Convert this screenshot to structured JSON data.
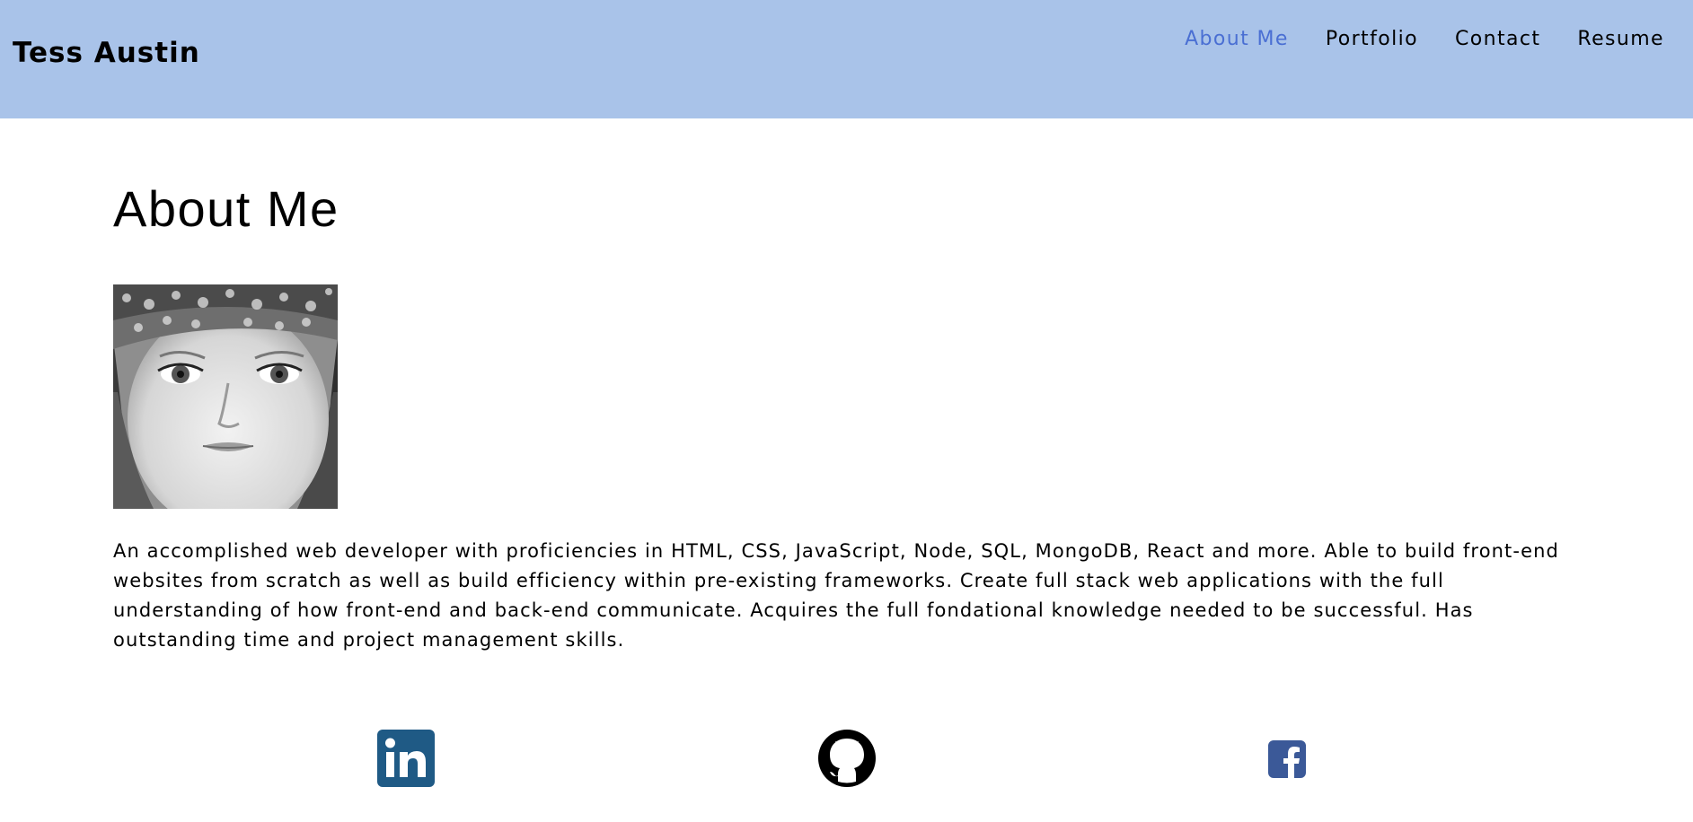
{
  "header": {
    "brand": "Tess Austin",
    "nav": [
      {
        "label": "About Me",
        "active": true
      },
      {
        "label": "Portfolio",
        "active": false
      },
      {
        "label": "Contact",
        "active": false
      },
      {
        "label": "Resume",
        "active": false
      }
    ]
  },
  "main": {
    "title": "About Me",
    "bio": "An accomplished web developer with proficiencies in HTML, CSS, JavaScript, Node, SQL, MongoDB, React and more. Able to build front-end websites from scratch as well as build efficiency within pre-existing frameworks. Create full stack web applications with the full understanding of how front-end and back-end communicate. Acquires the full fondational knowledge needed to be successful. Has outstanding time and project management skills."
  },
  "social": [
    {
      "icon": "linkedin-icon",
      "color": "#1f5a85"
    },
    {
      "icon": "github-icon",
      "color": "#000000"
    },
    {
      "icon": "facebook-icon",
      "color": "#3b5998"
    }
  ],
  "colors": {
    "header_bg": "#a9c3e9",
    "nav_active": "#4a6fd3"
  }
}
